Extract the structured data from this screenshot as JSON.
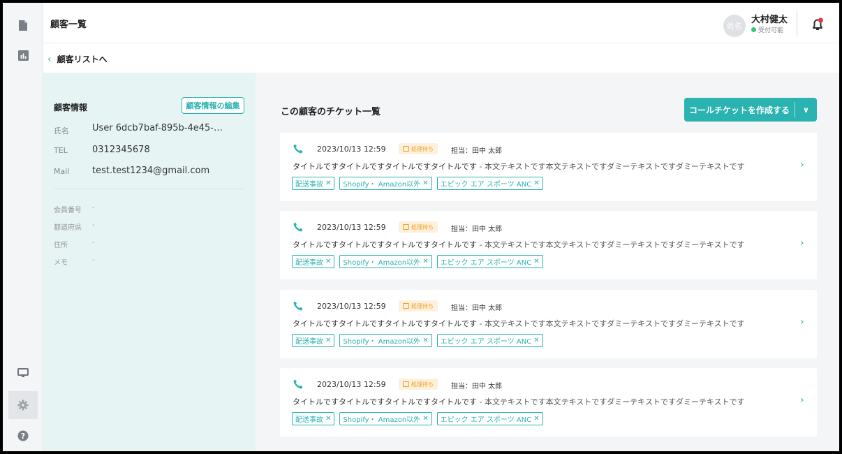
{
  "header": {
    "page_title": "顧客一覧",
    "user": {
      "avatar_text": "姓名",
      "name": "大村健太",
      "status": "受付可能"
    }
  },
  "breadcrumb": {
    "back_label": "顧客リストへ",
    "chevron": "‹"
  },
  "colors": {
    "accent": "#2ab3b0",
    "panel_bg": "#e6f5f3",
    "status_orange": "#f0a020",
    "online_green": "#3cc47c",
    "notification_red": "#e5363b"
  },
  "rail": {
    "icons": [
      "document-icon",
      "chart-icon",
      "monitor-icon",
      "gear-icon",
      "help-icon"
    ]
  },
  "customer": {
    "title": "顧客情報",
    "edit_label": "顧客情報の編集",
    "fields": [
      {
        "label": "氏名",
        "value": "User 6dcb7baf-895b-4e45-…"
      },
      {
        "label": "TEL",
        "value": "0312345678"
      },
      {
        "label": "Mail",
        "value": "test.test1234@gmail.com"
      }
    ],
    "meta": [
      {
        "label": "会員番号",
        "value": "-"
      },
      {
        "label": "都道府県",
        "value": "-"
      },
      {
        "label": "住所",
        "value": "-"
      },
      {
        "label": "メモ",
        "value": "-"
      }
    ]
  },
  "tickets_section": {
    "title": "この顧客のチケット一覧",
    "create_label": "コールチケットを作成する",
    "create_caret": "∨"
  },
  "tickets": [
    {
      "date": "2023/10/13 12:59",
      "status": "処理待ち",
      "assignee": "担当：田中 太郎",
      "title": "タイトルですタイトルですタイトルですタイトルです",
      "body": " - 本文テキストです本文テキストですダミーテキストですダミーテキストです",
      "tags": [
        "配送事故",
        "Shopify・ Amazon以外",
        "エピック エア スポーツ ANC"
      ]
    },
    {
      "date": "2023/10/13 12:59",
      "status": "処理待ち",
      "assignee": "担当：田中 太郎",
      "title": "タイトルですタイトルですタイトルですタイトルです",
      "body": " - 本文テキストです本文テキストですダミーテキストですダミーテキストです",
      "tags": [
        "配送事故",
        "Shopify・ Amazon以外",
        "エピック エア スポーツ ANC"
      ]
    },
    {
      "date": "2023/10/13 12:59",
      "status": "処理待ち",
      "assignee": "担当：田中 太郎",
      "title": "タイトルですタイトルですタイトルですタイトルです",
      "body": " - 本文テキストです本文テキストですダミーテキストですダミーテキストです",
      "tags": [
        "配送事故",
        "Shopify・ Amazon以外",
        "エピック エア スポーツ ANC"
      ]
    },
    {
      "date": "2023/10/13 12:59",
      "status": "処理待ち",
      "assignee": "担当：田中 太郎",
      "title": "タイトルですタイトルですタイトルですタイトルです",
      "body": " - 本文テキストです本文テキストですダミーテキストですダミーテキストです",
      "tags": [
        "配送事故",
        "Shopify・ Amazon以外",
        "エピック エア スポーツ ANC"
      ]
    }
  ]
}
